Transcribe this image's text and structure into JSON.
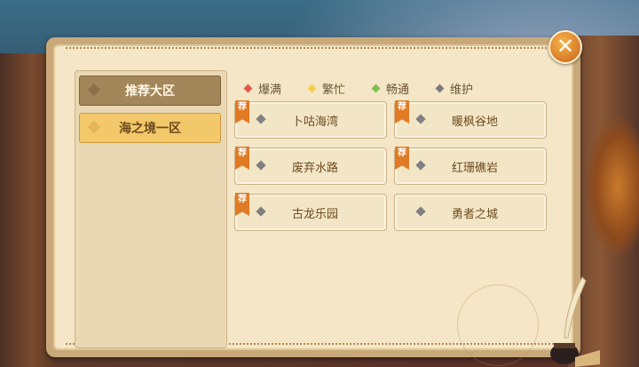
{
  "sidebar": {
    "items": [
      {
        "label": "推荐大区",
        "state": "active"
      },
      {
        "label": "海之境一区",
        "state": "normal"
      }
    ]
  },
  "legend": [
    {
      "label": "爆满",
      "color": "#e0574a"
    },
    {
      "label": "繁忙",
      "color": "#f2d24a"
    },
    {
      "label": "畅通",
      "color": "#7cc04f"
    },
    {
      "label": "维护",
      "color": "#7a7a82"
    }
  ],
  "servers": [
    {
      "name": "卜咕海湾",
      "recommended": true,
      "badge": "荐"
    },
    {
      "name": "暖枫谷地",
      "recommended": true,
      "badge": "荐"
    },
    {
      "name": "废弃水路",
      "recommended": true,
      "badge": "荐"
    },
    {
      "name": "红珊礁岩",
      "recommended": true,
      "badge": "荐"
    },
    {
      "name": "古龙乐园",
      "recommended": true,
      "badge": "荐"
    },
    {
      "name": "勇者之城",
      "recommended": false
    }
  ],
  "close_button": {
    "glyph": "✕",
    "icon": "close-icon"
  }
}
